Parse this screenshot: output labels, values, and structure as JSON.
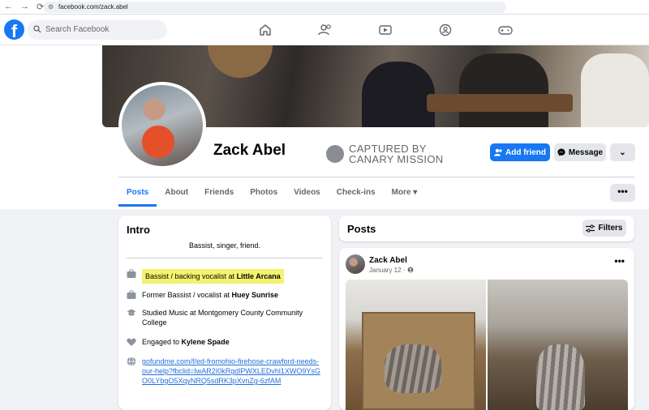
{
  "browser": {
    "url": "facebook.com/zack.abel",
    "nav": [
      "←",
      "→",
      "⟳"
    ]
  },
  "header": {
    "logo": "f",
    "search_placeholder": "Search Facebook",
    "nav_icons": [
      "home-icon",
      "friends-icon",
      "watch-icon",
      "groups-icon",
      "gaming-icon"
    ]
  },
  "profile": {
    "name": "Zack Abel",
    "watermark_line1": "CAPTURED BY",
    "watermark_line2": "CANARY MISSION",
    "add_friend": "Add friend",
    "message": "Message",
    "more": "⌄"
  },
  "tabs": [
    "Posts",
    "About",
    "Friends",
    "Photos",
    "Videos",
    "Check-ins",
    "More ▾"
  ],
  "tab_more": "•••",
  "intro": {
    "title": "Intro",
    "bio": "Bassist, singer, friend.",
    "items": [
      {
        "prefix": "Bassist / backing vocalist at ",
        "bold": "Little Arcana",
        "icon": "briefcase-icon"
      },
      {
        "prefix": "Former Bassist / vocalist at ",
        "bold": "Huey Sunrise",
        "icon": "briefcase-icon"
      },
      {
        "prefix": "Studied Music at Montgomery County Community College",
        "bold": "",
        "icon": "graduation-cap-icon"
      },
      {
        "prefix": "Engaged to ",
        "bold": "Kylene Spade",
        "icon": "heart-icon"
      },
      {
        "link": "gofundme.com/f/ed-fromohio-firehose-crawford-needs-our-help?fbclid=IwAR2I0kRgdlPWXLEDvhl1XWO9YsGO0LYbgO5XqyNRQ5sdRK3pXvnZg-6zfAM",
        "icon": "globe-icon"
      }
    ]
  },
  "posts": {
    "title": "Posts",
    "filters": "Filters",
    "post": {
      "author": "Zack Abel",
      "date": "January 12 · ",
      "menu": "•••"
    }
  },
  "colors": {
    "brand": "#1877f2",
    "highlight": "#f4f26e",
    "link": "#216fdb"
  }
}
